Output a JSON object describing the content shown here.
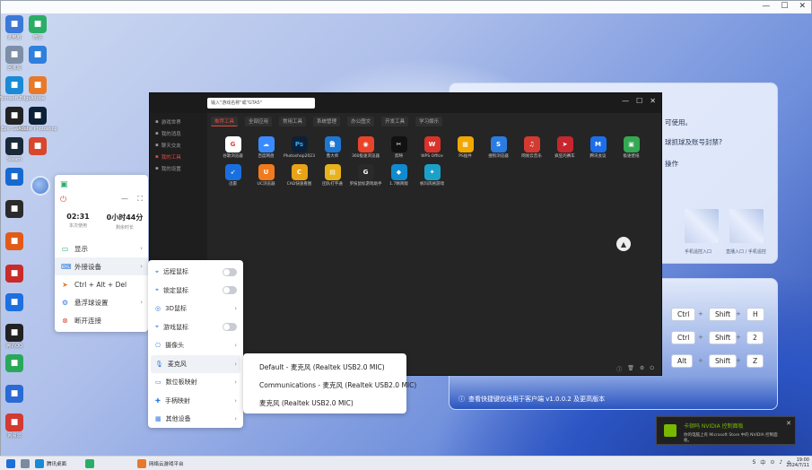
{
  "desktop_icons": [
    {
      "label": "此电脑",
      "icon": "computer-icon",
      "color": "#3b78d8"
    },
    {
      "label": "微信",
      "icon": "wechat-icon",
      "color": "#2aae67"
    },
    {
      "label": "回收站",
      "icon": "recycle-bin-icon",
      "color": "#7d8fa6"
    },
    {
      "label": "",
      "icon": "app-icon",
      "color": "#2f7fdc"
    },
    {
      "label": "Microsoft Edge",
      "icon": "edge-icon",
      "color": "#1a8ad4"
    },
    {
      "label": "Adobe",
      "icon": "adobe-icon",
      "color": "#e8792a"
    },
    {
      "label": "Epic Games",
      "icon": "epic-icon",
      "color": "#222222"
    },
    {
      "label": "Adobe Photoshop",
      "icon": "photoshop-icon",
      "color": "#0c2137"
    },
    {
      "label": "Steam",
      "icon": "steam-icon",
      "color": "#1b2838"
    },
    {
      "label": "",
      "icon": "game-icon",
      "color": "#d7462d"
    },
    {
      "label": "",
      "icon": "app-icon",
      "color": "#1769d0"
    },
    {
      "label": "",
      "icon": "app-icon",
      "color": "#2b2b2b"
    },
    {
      "label": "",
      "icon": "app-icon",
      "color": "#e25a17"
    },
    {
      "label": "",
      "icon": "app-icon",
      "color": "#c92a2a"
    },
    {
      "label": "",
      "icon": "app-icon",
      "color": "#1e6fe0"
    },
    {
      "label": "腾讯QQ",
      "icon": "qq-icon",
      "color": "#222222"
    },
    {
      "label": "",
      "icon": "player-icon",
      "color": "#2aa85a"
    },
    {
      "label": "",
      "icon": "app-icon",
      "color": "#2a6ad4"
    },
    {
      "label": "网易云",
      "icon": "netease-icon",
      "color": "#d33a31"
    }
  ],
  "outer_window": {
    "controls": [
      "—",
      "☐",
      "✕"
    ]
  },
  "right_panel_1": {
    "lines": [
      "可使用。",
      "球抓球及账号封禁?",
      "操作"
    ],
    "blur_labels": [
      "手机遥控入口",
      "直播入口 / 手机遥控"
    ]
  },
  "right_panel_2": {
    "shortcuts": [
      [
        "Ctrl",
        "Shift",
        "H"
      ],
      [
        "Ctrl",
        "Shift",
        "2"
      ],
      [
        "Alt",
        "Shift",
        "Z"
      ]
    ],
    "plus": "+",
    "footer": "查看快捷键仅适用于客户端 v1.0.0.2 及更高版本"
  },
  "app_window": {
    "search_placeholder": "输入\"游戏名称\"或\"GTA5\"",
    "controls": [
      "—",
      "☐",
      "✕"
    ],
    "sidebar": [
      "游戏世界",
      "我的消息",
      "聊天交友",
      "我的工具",
      "我的设置"
    ],
    "sidebar_active": 3,
    "tabs": [
      "推荐工具",
      "全部应用",
      "常用工具",
      "系统管理",
      "办公图文",
      "开发工具",
      "学习娱乐"
    ],
    "tab_active": 0,
    "apps": [
      {
        "name": "谷歌浏览器",
        "color": "#ffffff",
        "glyph": "G",
        "fg": "#db4437"
      },
      {
        "name": "百度网盘",
        "color": "#3a8bff",
        "glyph": "☁",
        "fg": "#fff"
      },
      {
        "name": "Photoshop2023",
        "color": "#0c2137",
        "glyph": "Ps",
        "fg": "#31a8ff"
      },
      {
        "name": "鲁大师",
        "color": "#1e77d2",
        "glyph": "鲁",
        "fg": "#fff"
      },
      {
        "name": "360极速浏览器",
        "color": "#e8442b",
        "glyph": "◉",
        "fg": "#fff"
      },
      {
        "name": "剪映",
        "color": "#111111",
        "glyph": "✂",
        "fg": "#fff"
      },
      {
        "name": "WPS Office",
        "color": "#d9332b",
        "glyph": "W",
        "fg": "#fff"
      },
      {
        "name": "PS插件",
        "color": "#f0a800",
        "glyph": "▦",
        "fg": "#fff"
      },
      {
        "name": "搜狗浏览器",
        "color": "#2a7ce2",
        "glyph": "S",
        "fg": "#fff"
      },
      {
        "name": "网易云音乐",
        "color": "#d33a31",
        "glyph": "♫",
        "fg": "#fff"
      },
      {
        "name": "疯狂的赛车",
        "color": "#c6262e",
        "glyph": "➤",
        "fg": "#fff"
      },
      {
        "name": "腾讯会议",
        "color": "#1c6fe8",
        "glyph": "M",
        "fg": "#fff"
      },
      {
        "name": "极速壁纸",
        "color": "#35a853",
        "glyph": "▣",
        "fg": "#fff"
      },
      {
        "name": "迅雷",
        "color": "#1a6fe0",
        "glyph": "➶",
        "fg": "#fff"
      },
      {
        "name": "UC浏览器",
        "color": "#f07a1e",
        "glyph": "U",
        "fg": "#fff"
      },
      {
        "name": "CAD快速看图",
        "color": "#e8a317",
        "glyph": "C",
        "fg": "#fff"
      },
      {
        "name": "团队打字通",
        "color": "#e7b21c",
        "glyph": "▤",
        "fg": "#fff"
      },
      {
        "name": "罗技鼠标游戏助手",
        "color": "#2a2a2a",
        "glyph": "G",
        "fg": "#fff"
      },
      {
        "name": "1.7精简版",
        "color": "#0f8bd0",
        "glyph": "◆",
        "fg": "#fff"
      },
      {
        "name": "帆玛风格游戏",
        "color": "#1ba1c8",
        "glyph": "✦",
        "fg": "#fff"
      }
    ]
  },
  "ball_menu": {
    "time_used": "02:31",
    "time_used_label": "本次使用",
    "time_left": "0小时44分",
    "time_left_label": "剩余时长",
    "items": [
      {
        "label": "显示",
        "icon": "display-icon",
        "arrow": "›"
      },
      {
        "label": "外接设备",
        "icon": "device-icon",
        "arrow": "›"
      },
      {
        "label": "Ctrl + Alt + Del",
        "icon": "send-icon",
        "arrow": ""
      },
      {
        "label": "悬浮球设置",
        "icon": "settings-icon",
        "arrow": "›"
      },
      {
        "label": "断开连接",
        "icon": "disconnect-icon",
        "arrow": ""
      }
    ]
  },
  "device_submenu": {
    "items": [
      {
        "label": "远程鼠标",
        "icon": "mouse-icon",
        "kind": "toggle"
      },
      {
        "label": "锁定鼠标",
        "icon": "lock-mouse-icon",
        "kind": "toggle"
      },
      {
        "label": "3D鼠标",
        "icon": "3d-mouse-icon",
        "kind": "arrow"
      },
      {
        "label": "游戏鼠标",
        "icon": "game-mouse-icon",
        "kind": "toggle"
      },
      {
        "label": "摄像头",
        "icon": "camera-icon",
        "kind": "arrow"
      },
      {
        "label": "麦克风",
        "icon": "microphone-icon",
        "kind": "arrow"
      },
      {
        "label": "数位板映射",
        "icon": "tablet-icon",
        "kind": "arrow"
      },
      {
        "label": "手柄映射",
        "icon": "gamepad-icon",
        "kind": "arrow"
      },
      {
        "label": "其他设备",
        "icon": "other-device-icon",
        "kind": "arrow"
      }
    ]
  },
  "mic_submenu": {
    "items": [
      "Default - 麦克风 (Realtek USB2.0 MIC)",
      "Communications - 麦克风 (Realtek USB2.0 MIC)",
      "麦克风 (Realtek USB2.0 MIC)"
    ]
  },
  "notification": {
    "title": "卡顿吗 NVIDIA 控制面板",
    "body": "你的电脑上有 Microsoft Store 中的 NVIDIA 控制面板。",
    "close": "✕"
  },
  "taskbar": {
    "items": [
      {
        "label": "",
        "color": "#1f6fd8"
      },
      {
        "label": "",
        "color": "#7a8aa0"
      },
      {
        "label": "腾讯桌面",
        "color": "#1a8ad4"
      },
      {
        "label": "",
        "color": "#2aae67"
      },
      {
        "label": "网络云游戏平台",
        "color": "#e8792a"
      }
    ],
    "tray": [
      "S",
      "中",
      "⊙",
      "♪",
      "⌂"
    ],
    "time": "19:00",
    "date": "2024/7/11"
  }
}
